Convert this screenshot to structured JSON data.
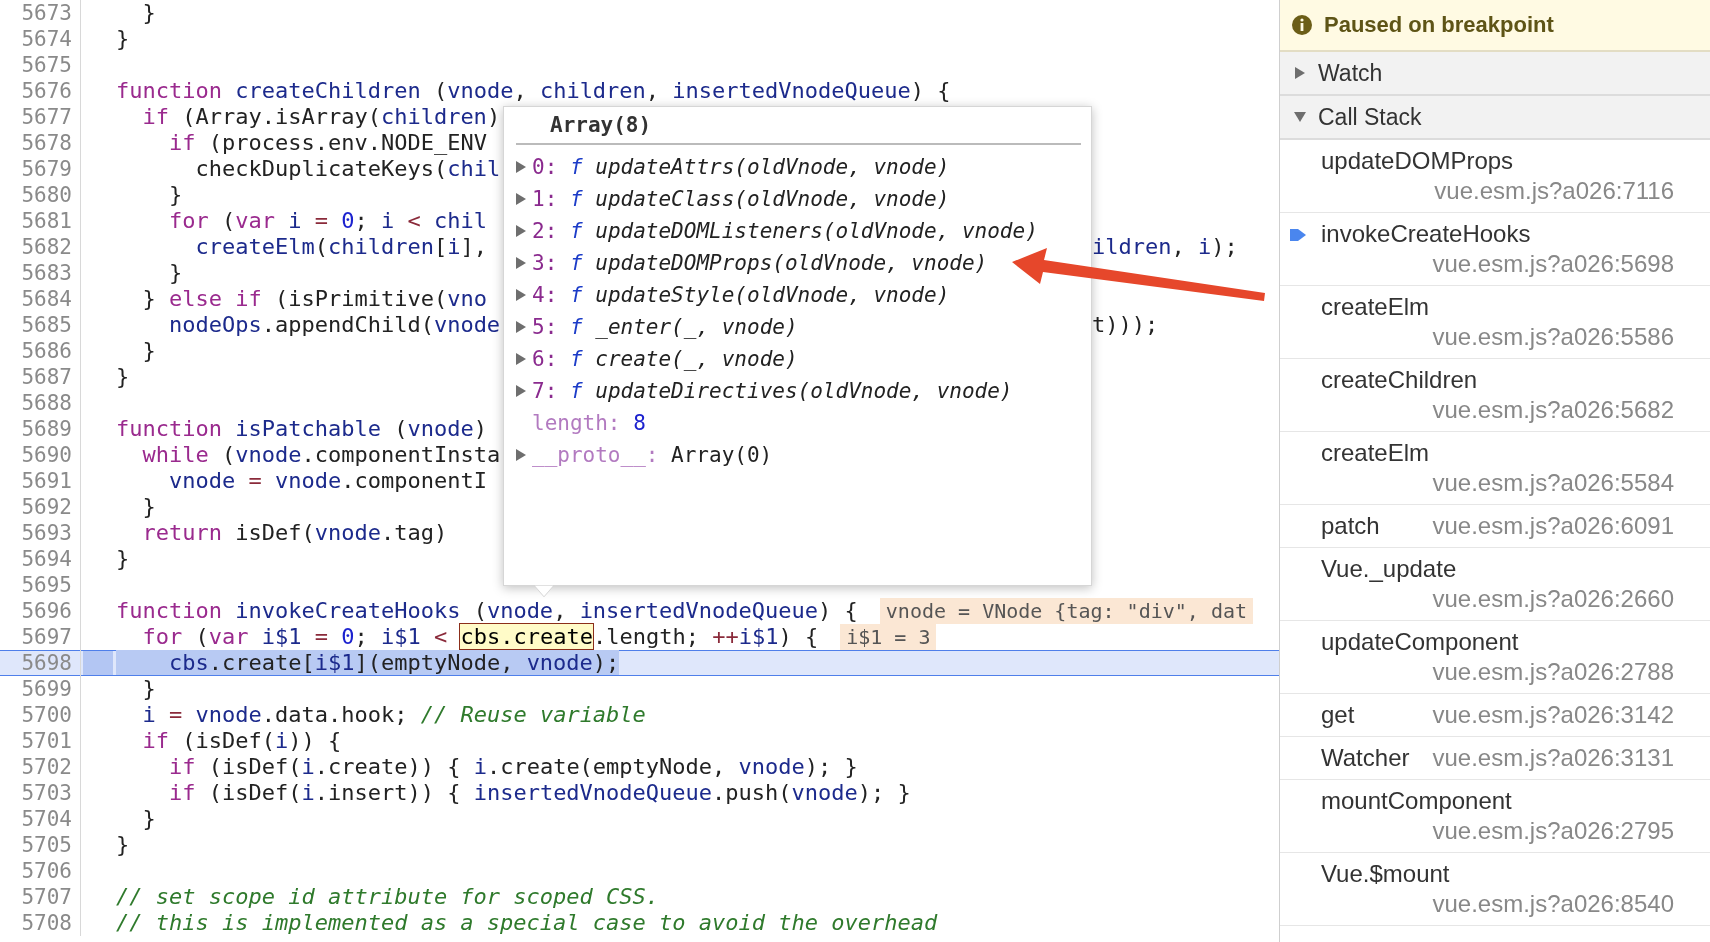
{
  "editor": {
    "lines": [
      {
        "number": "5673",
        "current": false,
        "tokens": [
          {
            "kind": "p",
            "text": "  }"
          }
        ]
      },
      {
        "number": "5674",
        "current": false,
        "tokens": [
          {
            "kind": "p",
            "text": "}"
          }
        ]
      },
      {
        "number": "5675",
        "current": false
      },
      {
        "number": "5676",
        "current": false,
        "tokens": [
          {
            "kind": "kw",
            "text": "function"
          },
          {
            "kind": "id",
            "text": " createChildren"
          },
          {
            "kind": "p",
            "text": " ("
          },
          {
            "kind": "id",
            "text": "vnode"
          },
          {
            "kind": "p",
            "text": ", "
          },
          {
            "kind": "id",
            "text": "children"
          },
          {
            "kind": "p",
            "text": ", "
          },
          {
            "kind": "id",
            "text": "insertedVnodeQueue"
          },
          {
            "kind": "p",
            "text": ") {"
          }
        ]
      },
      {
        "number": "5677",
        "current": false,
        "tokens": [
          {
            "kind": "kw",
            "text": "  if"
          },
          {
            "kind": "p",
            "text": " (Array.isArray("
          },
          {
            "kind": "id",
            "text": "children"
          },
          {
            "kind": "p",
            "text": ")"
          }
        ]
      },
      {
        "number": "5678",
        "current": false,
        "tokens": [
          {
            "kind": "kw",
            "text": "    if"
          },
          {
            "kind": "p",
            "text": " (process.env.NODE_ENV"
          }
        ]
      },
      {
        "number": "5679",
        "current": false,
        "tokens": [
          {
            "kind": "p",
            "text": "      checkDuplicateKeys("
          },
          {
            "kind": "id",
            "text": "chil"
          }
        ]
      },
      {
        "number": "5680",
        "current": false,
        "tokens": [
          {
            "kind": "p",
            "text": "    }"
          }
        ]
      },
      {
        "number": "5681",
        "current": false,
        "tokens": [
          {
            "kind": "kw",
            "text": "    for"
          },
          {
            "kind": "p",
            "text": " ("
          },
          {
            "kind": "kw",
            "text": "var"
          },
          {
            "kind": "id",
            "text": " i"
          },
          {
            "kind": "op",
            "text": " ="
          },
          {
            "kind": "num",
            "text": " 0"
          },
          {
            "kind": "p",
            "text": "; "
          },
          {
            "kind": "id",
            "text": "i"
          },
          {
            "kind": "op",
            "text": " <"
          },
          {
            "kind": "id",
            "text": " chil"
          }
        ]
      },
      {
        "number": "5682",
        "current": false,
        "tokens": [
          {
            "kind": "id",
            "text": "      createElm"
          },
          {
            "kind": "p",
            "text": "("
          },
          {
            "kind": "id",
            "text": "children"
          },
          {
            "kind": "p",
            "text": "["
          },
          {
            "kind": "id",
            "text": "i"
          },
          {
            "kind": "p",
            "text": "],"
          }
        ],
        "right_tokens": [
          {
            "kind": "id",
            "text": "ildren"
          },
          {
            "kind": "p",
            "text": ", "
          },
          {
            "kind": "id",
            "text": "i"
          },
          {
            "kind": "p",
            "text": ");"
          }
        ]
      },
      {
        "number": "5683",
        "current": false,
        "tokens": [
          {
            "kind": "p",
            "text": "    }"
          }
        ]
      },
      {
        "number": "5684",
        "current": false,
        "tokens": [
          {
            "kind": "p",
            "text": "  }"
          },
          {
            "kind": "kw",
            "text": " else if"
          },
          {
            "kind": "p",
            "text": " (isPrimitive("
          },
          {
            "kind": "id",
            "text": "vno"
          }
        ]
      },
      {
        "number": "5685",
        "current": false,
        "tokens": [
          {
            "kind": "id",
            "text": "    nodeOps"
          },
          {
            "kind": "p",
            "text": ".appendChild("
          },
          {
            "kind": "id",
            "text": "vnode"
          }
        ],
        "right_tokens": [
          {
            "kind": "p",
            "text": "t)));"
          }
        ]
      },
      {
        "number": "5686",
        "current": false,
        "tokens": [
          {
            "kind": "p",
            "text": "  }"
          }
        ]
      },
      {
        "number": "5687",
        "current": false,
        "tokens": [
          {
            "kind": "p",
            "text": "}"
          }
        ]
      },
      {
        "number": "5688",
        "current": false
      },
      {
        "number": "5689",
        "current": false,
        "tokens": [
          {
            "kind": "kw",
            "text": "function"
          },
          {
            "kind": "id",
            "text": " isPatchable"
          },
          {
            "kind": "p",
            "text": " ("
          },
          {
            "kind": "id",
            "text": "vnode"
          },
          {
            "kind": "p",
            "text": ")"
          }
        ]
      },
      {
        "number": "5690",
        "current": false,
        "tokens": [
          {
            "kind": "kw",
            "text": "  while"
          },
          {
            "kind": "p",
            "text": " ("
          },
          {
            "kind": "id",
            "text": "vnode"
          },
          {
            "kind": "p",
            "text": ".componentInsta"
          }
        ]
      },
      {
        "number": "5691",
        "current": false,
        "tokens": [
          {
            "kind": "id",
            "text": "    vnode"
          },
          {
            "kind": "op",
            "text": " ="
          },
          {
            "kind": "id",
            "text": " vnode"
          },
          {
            "kind": "p",
            "text": ".componentI"
          }
        ]
      },
      {
        "number": "5692",
        "current": false,
        "tokens": [
          {
            "kind": "p",
            "text": "  }"
          }
        ]
      },
      {
        "number": "5693",
        "current": false,
        "tokens": [
          {
            "kind": "kw",
            "text": "  return"
          },
          {
            "kind": "p",
            "text": " isDef("
          },
          {
            "kind": "id",
            "text": "vnode"
          },
          {
            "kind": "p",
            "text": ".tag)"
          }
        ]
      },
      {
        "number": "5694",
        "current": false,
        "tokens": [
          {
            "kind": "p",
            "text": "}"
          }
        ]
      },
      {
        "number": "5695",
        "current": false
      },
      {
        "number": "5696",
        "current": false,
        "tokens": [
          {
            "kind": "kw",
            "text": "function"
          },
          {
            "kind": "id",
            "text": " invokeCreateHooks"
          },
          {
            "kind": "p",
            "text": " ("
          },
          {
            "kind": "id",
            "text": "vnode"
          },
          {
            "kind": "p",
            "text": ", "
          },
          {
            "kind": "id",
            "text": "insertedVnodeQueue"
          },
          {
            "kind": "p",
            "text": ") {"
          }
        ],
        "inline_value": "vnode = VNode {tag: \"div\", dat"
      },
      {
        "number": "5697",
        "current": false,
        "tokens": [
          {
            "kind": "kw",
            "text": "  for"
          },
          {
            "kind": "p",
            "text": " ("
          },
          {
            "kind": "kw",
            "text": "var"
          },
          {
            "kind": "id",
            "text": " i$1"
          },
          {
            "kind": "op",
            "text": " ="
          },
          {
            "kind": "num",
            "text": " 0"
          },
          {
            "kind": "p",
            "text": "; "
          },
          {
            "kind": "id",
            "text": "i$1"
          },
          {
            "kind": "op",
            "text": " < "
          },
          {
            "kind": "hl",
            "text": "cbs.create"
          },
          {
            "kind": "p",
            "text": ".length; "
          },
          {
            "kind": "op",
            "text": "++"
          },
          {
            "kind": "id",
            "text": "i$1"
          },
          {
            "kind": "p",
            "text": ") {"
          }
        ],
        "inline_value": "i$1 = 3"
      },
      {
        "number": "5698",
        "current": true,
        "tokens": [
          {
            "kind": "id",
            "text": "    cbs"
          },
          {
            "kind": "p",
            "text": ".create["
          },
          {
            "kind": "id",
            "text": "i$1"
          },
          {
            "kind": "p",
            "text": "](emptyNode, "
          },
          {
            "kind": "id",
            "text": "vnode"
          },
          {
            "kind": "p",
            "text": ");"
          }
        ]
      },
      {
        "number": "5699",
        "current": false,
        "tokens": [
          {
            "kind": "p",
            "text": "  }"
          }
        ]
      },
      {
        "number": "5700",
        "current": false,
        "tokens": [
          {
            "kind": "id",
            "text": "  i"
          },
          {
            "kind": "op",
            "text": " ="
          },
          {
            "kind": "id",
            "text": " vnode"
          },
          {
            "kind": "p",
            "text": ".data.hook; "
          },
          {
            "kind": "cmt",
            "text": "// Reuse variable"
          }
        ]
      },
      {
        "number": "5701",
        "current": false,
        "tokens": [
          {
            "kind": "kw",
            "text": "  if"
          },
          {
            "kind": "p",
            "text": " (isDef("
          },
          {
            "kind": "id",
            "text": "i"
          },
          {
            "kind": "p",
            "text": ")) {"
          }
        ]
      },
      {
        "number": "5702",
        "current": false,
        "tokens": [
          {
            "kind": "kw",
            "text": "    if"
          },
          {
            "kind": "p",
            "text": " (isDef("
          },
          {
            "kind": "id",
            "text": "i"
          },
          {
            "kind": "p",
            "text": ".create)) { "
          },
          {
            "kind": "id",
            "text": "i"
          },
          {
            "kind": "p",
            "text": ".create(emptyNode, "
          },
          {
            "kind": "id",
            "text": "vnode"
          },
          {
            "kind": "p",
            "text": "); }"
          }
        ]
      },
      {
        "number": "5703",
        "current": false,
        "tokens": [
          {
            "kind": "kw",
            "text": "    if"
          },
          {
            "kind": "p",
            "text": " (isDef("
          },
          {
            "kind": "id",
            "text": "i"
          },
          {
            "kind": "p",
            "text": ".insert)) { "
          },
          {
            "kind": "id",
            "text": "insertedVnodeQueue"
          },
          {
            "kind": "p",
            "text": ".push("
          },
          {
            "kind": "id",
            "text": "vnode"
          },
          {
            "kind": "p",
            "text": "); }"
          }
        ]
      },
      {
        "number": "5704",
        "current": false,
        "tokens": [
          {
            "kind": "p",
            "text": "  }"
          }
        ]
      },
      {
        "number": "5705",
        "current": false,
        "tokens": [
          {
            "kind": "p",
            "text": "}"
          }
        ]
      },
      {
        "number": "5706",
        "current": false
      },
      {
        "number": "5707",
        "current": false,
        "tokens": [
          {
            "kind": "cmt",
            "text": "// set scope id attribute for scoped CSS."
          }
        ]
      },
      {
        "number": "5708",
        "current": false,
        "tokens": [
          {
            "kind": "cmt",
            "text": "// this is implemented as a special case to avoid the overhead"
          }
        ]
      }
    ]
  },
  "popup": {
    "title": "Array(8)",
    "items": [
      {
        "index": "0:",
        "type": "f",
        "signature": "updateAttrs(oldVnode, vnode)"
      },
      {
        "index": "1:",
        "type": "f",
        "signature": "updateClass(oldVnode, vnode)"
      },
      {
        "index": "2:",
        "type": "f",
        "signature": "updateDOMListeners(oldVnode, vnode)"
      },
      {
        "index": "3:",
        "type": "f",
        "signature": "updateDOMProps(oldVnode, vnode)"
      },
      {
        "index": "4:",
        "type": "f",
        "signature": "updateStyle(oldVnode, vnode)"
      },
      {
        "index": "5:",
        "type": "f",
        "signature": "_enter(_, vnode)"
      },
      {
        "index": "6:",
        "type": "f",
        "signature": "create(_, vnode)"
      },
      {
        "index": "7:",
        "type": "f",
        "signature": "updateDirectives(oldVnode, vnode)"
      }
    ],
    "length_key": "length:",
    "length_value": "8",
    "proto_key": "__proto__:",
    "proto_value": "Array(0)"
  },
  "annotation_arrow": true,
  "sidebar": {
    "banner": "Paused on breakpoint",
    "sections": [
      {
        "label": "Watch",
        "expanded": false
      },
      {
        "label": "Call Stack",
        "expanded": true
      }
    ],
    "call_stack": [
      {
        "name": "updateDOMProps",
        "location": "vue.esm.js?a026:7116",
        "selected": false
      },
      {
        "name": "invokeCreateHooks",
        "location": "vue.esm.js?a026:5698",
        "selected": true
      },
      {
        "name": "createElm",
        "location": "vue.esm.js?a026:5586",
        "selected": false
      },
      {
        "name": "createChildren",
        "location": "vue.esm.js?a026:5682",
        "selected": false
      },
      {
        "name": "createElm",
        "location": "vue.esm.js?a026:5584",
        "selected": false
      },
      {
        "name": "patch",
        "location": "vue.esm.js?a026:6091",
        "selected": false
      },
      {
        "name": "Vue._update",
        "location": "vue.esm.js?a026:2660",
        "selected": false
      },
      {
        "name": "updateComponent",
        "location": "vue.esm.js?a026:2788",
        "selected": false
      },
      {
        "name": "get",
        "location": "vue.esm.js?a026:3142",
        "selected": false
      },
      {
        "name": "Watcher",
        "location": "vue.esm.js?a026:3131",
        "selected": false
      },
      {
        "name": "mountComponent",
        "location": "vue.esm.js?a026:2795",
        "selected": false
      },
      {
        "name": "Vue.$mount",
        "location": "vue.esm.js?a026:8540",
        "selected": false
      }
    ]
  }
}
